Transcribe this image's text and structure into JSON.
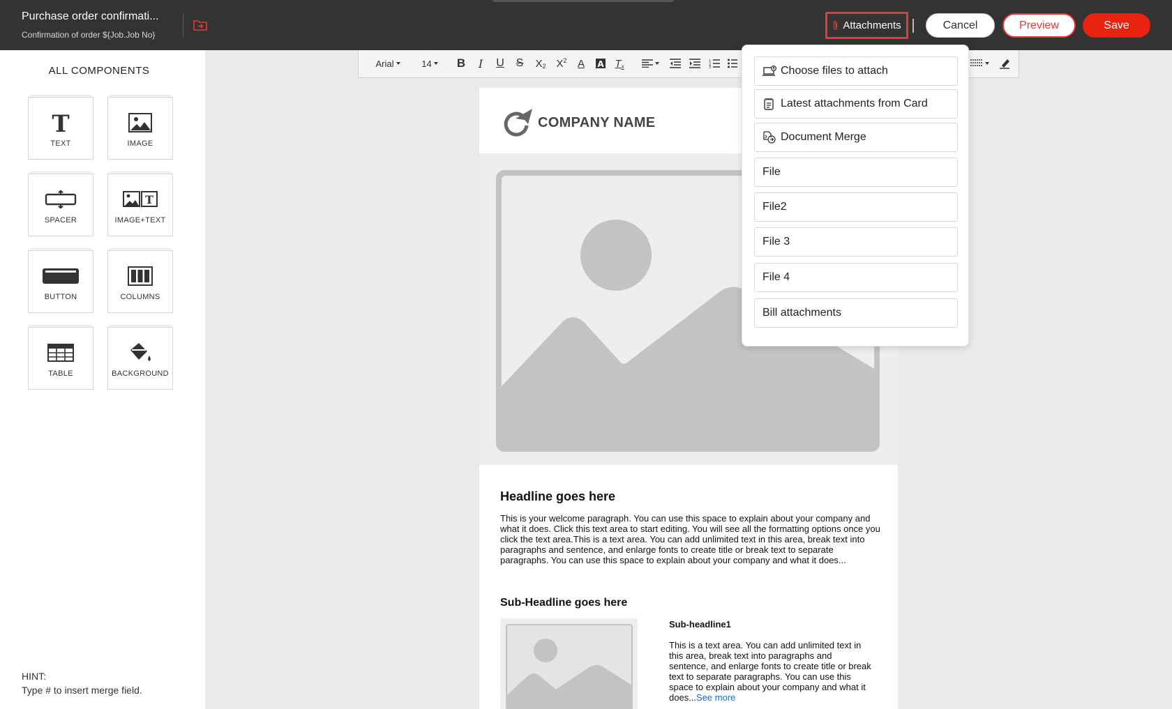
{
  "header": {
    "title": "Purchase order confirmati...",
    "subtitle": "Confirmation of order ${Job.Job No}",
    "attachments_label": "Attachments",
    "cancel_label": "Cancel",
    "preview_label": "Preview",
    "save_label": "Save",
    "accent_color": "#e53935"
  },
  "sidebar": {
    "title": "ALL COMPONENTS",
    "components": [
      {
        "label": "TEXT",
        "icon": "text-icon"
      },
      {
        "label": "IMAGE",
        "icon": "image-icon"
      },
      {
        "label": "SPACER",
        "icon": "spacer-icon"
      },
      {
        "label": "IMAGE+TEXT",
        "icon": "image-text-icon"
      },
      {
        "label": "BUTTON",
        "icon": "button-icon"
      },
      {
        "label": "COLUMNS",
        "icon": "columns-icon"
      },
      {
        "label": "TABLE",
        "icon": "table-icon"
      },
      {
        "label": "BACKGROUND",
        "icon": "paint-bucket-icon"
      }
    ],
    "hint_title": "HINT:",
    "hint_text": "Type # to insert merge field."
  },
  "toolbar": {
    "font": "Arial",
    "size": "14"
  },
  "canvas": {
    "company": "COMPANY NAME",
    "headline": "Headline goes here",
    "paragraph": "This is your welcome paragraph. You can use this space to explain about your company and what it does. Click this text area to start editing. You will see all the formatting options once you click the text area.This is a text area. You can add unlimited text in this area, break text into paragraphs and sentence, and enlarge fonts to create title or break text to separate paragraphs. You can use this space to explain about your company and what it does...",
    "subheadline": "Sub-Headline goes here",
    "sub1": "Sub-headline1",
    "paragraph2": "This is a text area. You can add unlimited text in this area, break text into paragraphs and sentence, and enlarge fonts to create title or break text to separate paragraphs. You can use this space to explain about your company and what it does...",
    "see_more": "See more"
  },
  "attachments_menu": {
    "items": [
      {
        "label": "Choose files to attach",
        "icon": "laptop-upload-icon"
      },
      {
        "label": "Latest attachments from Card",
        "icon": "card-list-icon"
      },
      {
        "label": "Document Merge",
        "icon": "document-merge-icon"
      },
      {
        "label": "File"
      },
      {
        "label": "File2"
      },
      {
        "label": "File 3"
      },
      {
        "label": "File 4"
      },
      {
        "label": "Bill attachments"
      }
    ]
  }
}
